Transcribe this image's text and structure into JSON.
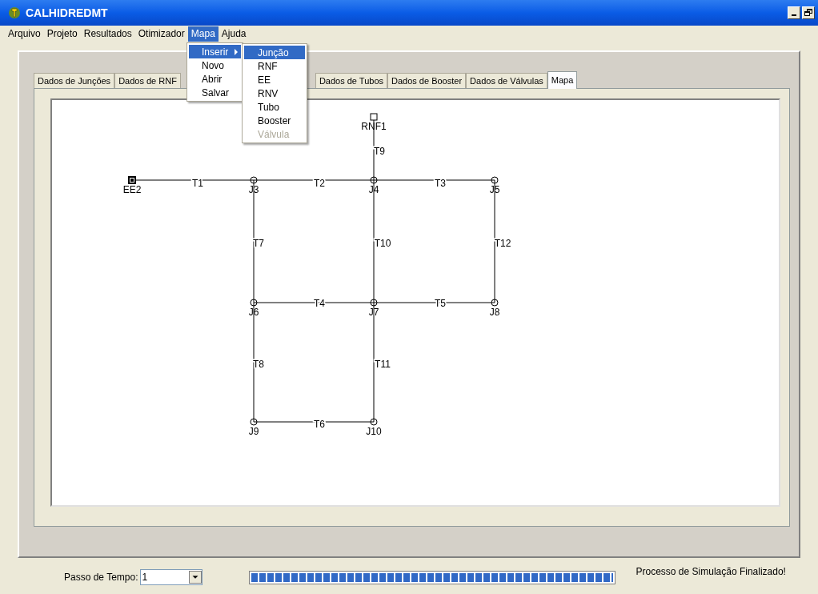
{
  "window": {
    "title": "CALHIDREDMT"
  },
  "menubar": [
    {
      "label": "Arquivo",
      "selected": false
    },
    {
      "label": "Projeto",
      "selected": false
    },
    {
      "label": "Resultados",
      "selected": false
    },
    {
      "label": "Otimizador",
      "selected": false
    },
    {
      "label": "Mapa",
      "selected": true
    },
    {
      "label": "Ajuda",
      "selected": false
    }
  ],
  "menu": [
    {
      "label": "Inserir",
      "kind": "submenu",
      "selected": true
    },
    {
      "label": "Novo",
      "kind": "item",
      "selected": false
    },
    {
      "label": "Abrir",
      "kind": "item",
      "selected": false
    },
    {
      "label": "Salvar",
      "kind": "item",
      "selected": false
    }
  ],
  "submenu": [
    {
      "label": "Junção",
      "selected": true,
      "disabled": false
    },
    {
      "label": "RNF",
      "selected": false,
      "disabled": false
    },
    {
      "label": "EE",
      "selected": false,
      "disabled": false
    },
    {
      "label": "RNV",
      "selected": false,
      "disabled": false
    },
    {
      "label": "Tubo",
      "selected": false,
      "disabled": false
    },
    {
      "label": "Booster",
      "selected": false,
      "disabled": false
    },
    {
      "label": "Válvula",
      "selected": false,
      "disabled": true
    }
  ],
  "tabs_left": [
    {
      "label": "Dados de Junções",
      "selected": false
    },
    {
      "label": "Dados de RNF",
      "selected": false
    }
  ],
  "tabs_right": [
    {
      "label": "Dados de Tubos",
      "selected": false
    },
    {
      "label": "Dados de Booster",
      "selected": false
    },
    {
      "label": "Dados de Válvulas",
      "selected": false
    },
    {
      "label": "Mapa",
      "selected": true
    }
  ],
  "map": {
    "nodes": [
      {
        "label": "RNF1",
        "kind": "reservoir"
      },
      {
        "label": "EE2",
        "kind": "pump"
      },
      {
        "label": "J3",
        "kind": "junction"
      },
      {
        "label": "J4",
        "kind": "junction"
      },
      {
        "label": "J5",
        "kind": "junction"
      },
      {
        "label": "J6",
        "kind": "junction"
      },
      {
        "label": "J7",
        "kind": "junction"
      },
      {
        "label": "J8",
        "kind": "junction"
      },
      {
        "label": "J9",
        "kind": "junction"
      },
      {
        "label": "J10",
        "kind": "junction"
      }
    ],
    "pipes": [
      {
        "label": "T9"
      },
      {
        "label": "T1"
      },
      {
        "label": "T2"
      },
      {
        "label": "T3"
      },
      {
        "label": "T7"
      },
      {
        "label": "T10"
      },
      {
        "label": "T12"
      },
      {
        "label": "T4"
      },
      {
        "label": "T5"
      },
      {
        "label": "T8"
      },
      {
        "label": "T11"
      },
      {
        "label": "T6"
      }
    ]
  },
  "time_step": {
    "label": "Passo de Tempo:",
    "value": "1"
  },
  "progress": {
    "level": 1
  },
  "status": "Processo de Simulação Finalizado!"
}
